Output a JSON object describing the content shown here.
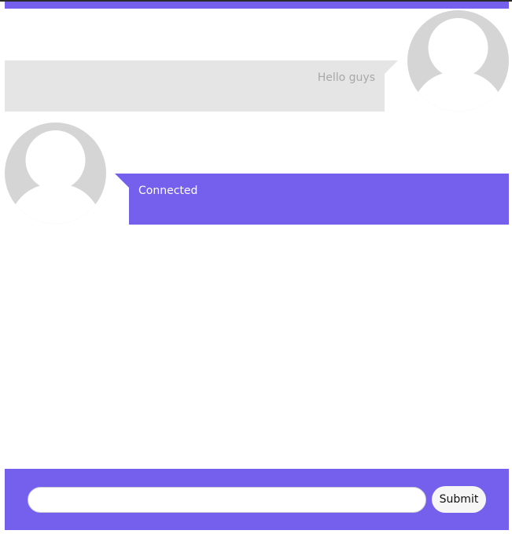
{
  "messages": [
    {
      "sender": "other",
      "text": "Hello guys",
      "avatar_icon": "user-silhouette-icon",
      "bubble_color": "#e5e5e5",
      "text_color": "#a8a8a8"
    },
    {
      "sender": "self",
      "text": "Connected",
      "avatar_icon": "user-silhouette-icon",
      "bubble_color": "#7460ec",
      "text_color": "#ffffff"
    }
  ],
  "composer": {
    "input_value": "",
    "input_placeholder": "",
    "submit_label": "Submit"
  },
  "colors": {
    "accent": "#7460ec",
    "avatar": "#d5d5d5",
    "avatar_figure": "#ffffff"
  }
}
